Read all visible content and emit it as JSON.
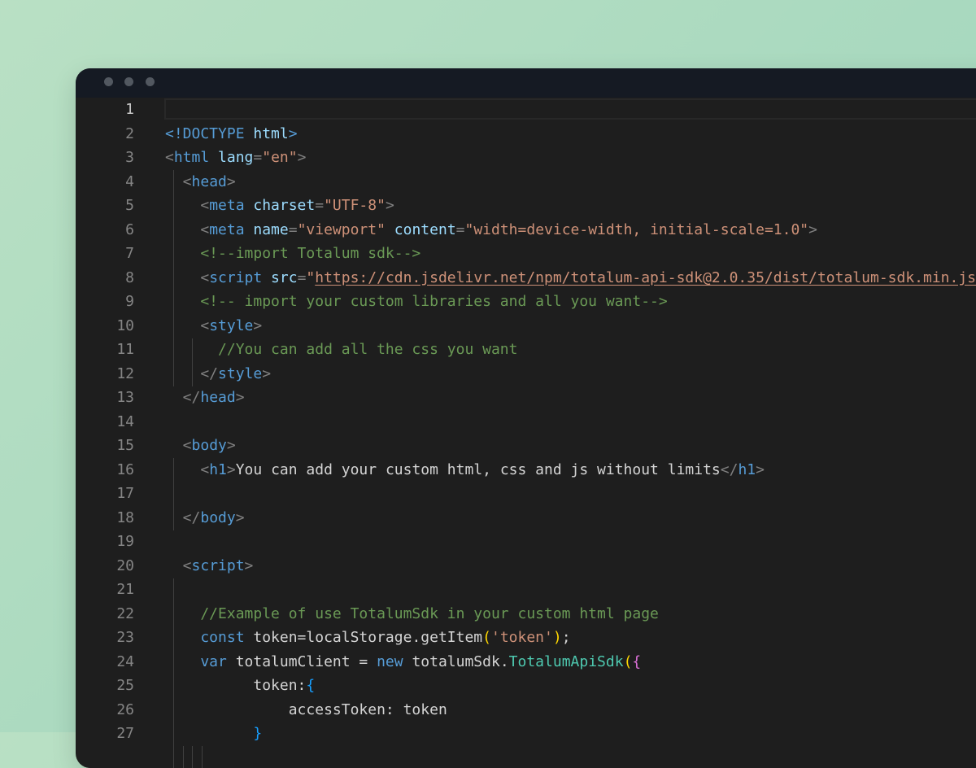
{
  "window": {
    "controls": [
      "window-dot",
      "window-dot",
      "window-dot"
    ]
  },
  "editor": {
    "line_numbers": [
      "1",
      "2",
      "3",
      "4",
      "5",
      "6",
      "7",
      "8",
      "9",
      "10",
      "11",
      "12",
      "13",
      "14",
      "15",
      "16",
      "17",
      "18",
      "19",
      "20",
      "21",
      "22",
      "23",
      "24",
      "25",
      "26",
      "27"
    ],
    "active_line": 1,
    "lines": [
      [],
      [
        [
          "tn",
          "<!DOCTYPE "
        ],
        [
          "an",
          "html"
        ],
        [
          "tn",
          ">"
        ]
      ],
      [
        [
          "t",
          "<"
        ],
        [
          "tn",
          "html "
        ],
        [
          "an",
          "lang"
        ],
        [
          "t",
          "="
        ],
        [
          "av",
          "\"en\""
        ],
        [
          "t",
          ">"
        ]
      ],
      [
        [
          "t",
          "  <"
        ],
        [
          "tn",
          "head"
        ],
        [
          "t",
          ">"
        ]
      ],
      [
        [
          "t",
          "    <"
        ],
        [
          "tn",
          "meta "
        ],
        [
          "an",
          "charset"
        ],
        [
          "t",
          "="
        ],
        [
          "av",
          "\"UTF-8\""
        ],
        [
          "t",
          ">"
        ]
      ],
      [
        [
          "t",
          "    <"
        ],
        [
          "tn",
          "meta "
        ],
        [
          "an",
          "name"
        ],
        [
          "t",
          "="
        ],
        [
          "av",
          "\"viewport\" "
        ],
        [
          "an",
          "content"
        ],
        [
          "t",
          "="
        ],
        [
          "av",
          "\"width=device-width, initial-scale=1.0\""
        ],
        [
          "t",
          ">"
        ]
      ],
      [
        [
          "cm",
          "    <!--import Totalum sdk-->"
        ]
      ],
      [
        [
          "t",
          "    <"
        ],
        [
          "tn",
          "script "
        ],
        [
          "an",
          "src"
        ],
        [
          "t",
          "="
        ],
        [
          "av",
          "\""
        ],
        [
          "link",
          "https://cdn.jsdelivr.net/npm/totalum-api-sdk@2.0.35/dist/totalum-sdk.min.js"
        ]
      ],
      [
        [
          "cm",
          "    <!-- import your custom libraries and all you want-->"
        ]
      ],
      [
        [
          "t",
          "    <"
        ],
        [
          "tn",
          "style"
        ],
        [
          "t",
          ">"
        ]
      ],
      [
        [
          "cm",
          "      //You can add all the css you want"
        ]
      ],
      [
        [
          "t",
          "    </"
        ],
        [
          "tn",
          "style"
        ],
        [
          "t",
          ">"
        ]
      ],
      [
        [
          "t",
          "  </"
        ],
        [
          "tn",
          "head"
        ],
        [
          "t",
          ">"
        ]
      ],
      [],
      [
        [
          "t",
          "  <"
        ],
        [
          "tn",
          "body"
        ],
        [
          "t",
          ">"
        ]
      ],
      [
        [
          "t",
          "    <"
        ],
        [
          "tn",
          "h1"
        ],
        [
          "t",
          ">"
        ],
        [
          "tx",
          "You can add your custom html, css and js without limits"
        ],
        [
          "t",
          "</"
        ],
        [
          "tn",
          "h1"
        ],
        [
          "t",
          ">"
        ]
      ],
      [],
      [
        [
          "t",
          "  </"
        ],
        [
          "tn",
          "body"
        ],
        [
          "t",
          ">"
        ]
      ],
      [],
      [
        [
          "t",
          "  <"
        ],
        [
          "tn",
          "script"
        ],
        [
          "t",
          ">"
        ]
      ],
      [],
      [
        [
          "cm",
          "    //Example of use TotalumSdk in your custom html page"
        ]
      ],
      [
        [
          "kw",
          "    const "
        ],
        [
          "tx",
          "token=localStorage.getItem"
        ],
        [
          "br1",
          "("
        ],
        [
          "av",
          "'token'"
        ],
        [
          "br1",
          ")"
        ],
        [
          "tx",
          ";"
        ]
      ],
      [
        [
          "kw",
          "    var "
        ],
        [
          "tx",
          "totalumClient = "
        ],
        [
          "kw",
          "new "
        ],
        [
          "tx",
          "totalumSdk."
        ],
        [
          "cl",
          "TotalumApiSdk"
        ],
        [
          "br1",
          "("
        ],
        [
          "br2",
          "{"
        ]
      ],
      [
        [
          "tx",
          "          token:"
        ],
        [
          "br3",
          "{"
        ]
      ],
      [
        [
          "tx",
          "              accessToken: token"
        ]
      ],
      [
        [
          "br3",
          "          }"
        ]
      ]
    ]
  }
}
